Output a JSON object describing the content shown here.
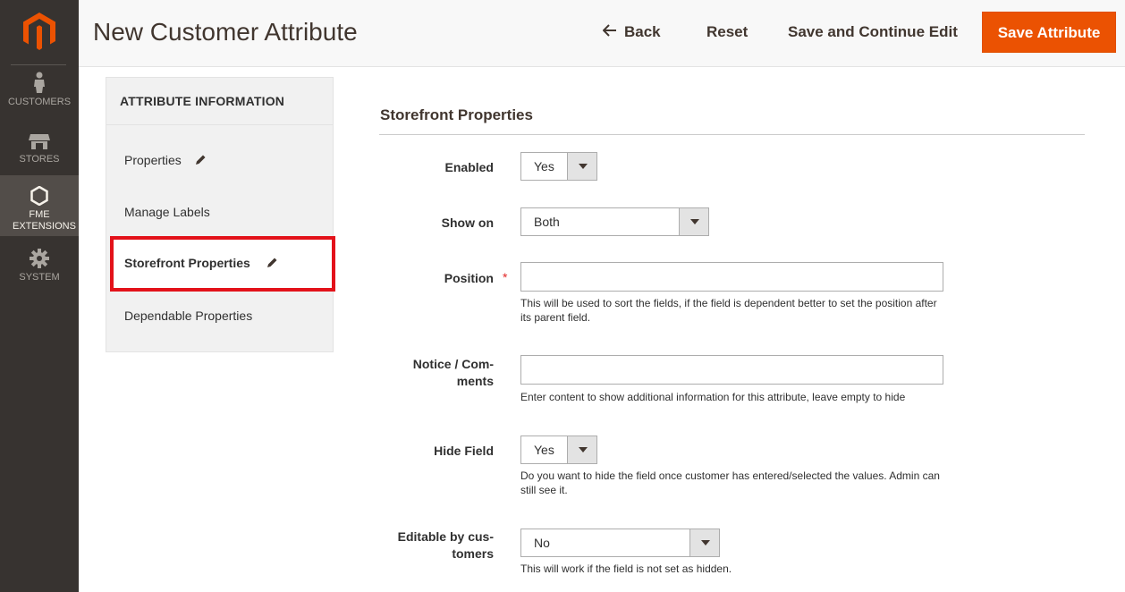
{
  "nav": {
    "items": [
      {
        "label": "CUSTOMERS",
        "icon": "person-icon"
      },
      {
        "label": "STORES",
        "icon": "store-icon"
      },
      {
        "label": "FME EXTENSIONS",
        "icon": "hexagon-icon"
      },
      {
        "label": "SYSTEM",
        "icon": "gear-icon"
      }
    ],
    "colors": {
      "background": "#373330",
      "active": "#524d49",
      "logo": "#eb5202"
    }
  },
  "header": {
    "title": "New Customer Attribute",
    "back_label": "Back",
    "reset_label": "Reset",
    "save_continue_label": "Save and Continue Edit",
    "save_label": "Save Attribute"
  },
  "tabs": {
    "title": "ATTRIBUTE INFORMATION",
    "items": [
      {
        "label": "Properties"
      },
      {
        "label": "Manage Labels"
      },
      {
        "label": "Storefront Properties"
      },
      {
        "label": "Dependable Properties"
      }
    ]
  },
  "form": {
    "section_title": "Storefront Properties",
    "enabled": {
      "label": "Enabled",
      "value": "Yes"
    },
    "show_on": {
      "label": "Show on",
      "value": "Both"
    },
    "position": {
      "label": "Position",
      "value": "",
      "note": "This will be used to sort the fields, if the field is dependent better to set the position after its parent field."
    },
    "notice": {
      "label_line1": "Notice / Com-",
      "label_line2": "ments",
      "value": "",
      "note": "Enter content to show additional information for this attribute, leave empty to hide"
    },
    "hide_field": {
      "label": "Hide Field",
      "value": "Yes",
      "note": "Do you want to hide the field once customer has entered/selected the values. Admin can still see it."
    },
    "editable": {
      "label_line1": "Editable by cus-",
      "label_line2": "tomers",
      "value": "No",
      "note": "This will work if the field is not set as hidden."
    }
  },
  "colors": {
    "primary": "#eb5202",
    "highlight": "#e3121a"
  }
}
